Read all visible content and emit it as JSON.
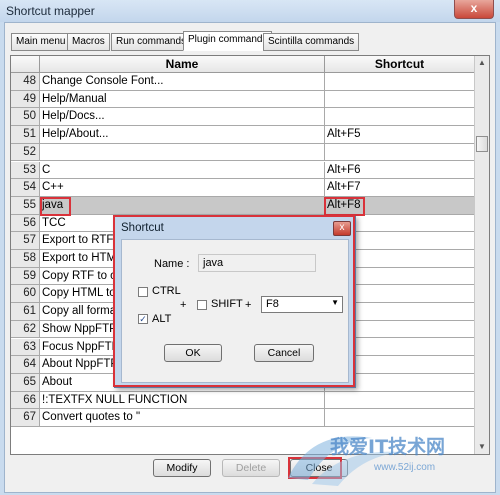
{
  "window": {
    "title": "Shortcut mapper",
    "close_glyph": "x"
  },
  "tabs": [
    "Main menu",
    "Macros",
    "Run commands",
    "Plugin commands",
    "Scintilla commands"
  ],
  "active_tab": "Plugin commands",
  "grid": {
    "columns": [
      "Name",
      "Shortcut"
    ],
    "rows": [
      {
        "num": "48",
        "name": "Change Console Font...",
        "shortcut": ""
      },
      {
        "num": "49",
        "name": "Help/Manual",
        "shortcut": ""
      },
      {
        "num": "50",
        "name": "Help/Docs...",
        "shortcut": ""
      },
      {
        "num": "51",
        "name": "Help/About...",
        "shortcut": "Alt+F5"
      },
      {
        "num": "52",
        "name": "",
        "shortcut": ""
      },
      {
        "num": "53",
        "name": "C",
        "shortcut": "Alt+F6"
      },
      {
        "num": "54",
        "name": "C++",
        "shortcut": "Alt+F7"
      },
      {
        "num": "55",
        "name": "java",
        "shortcut": "Alt+F8",
        "selected": true
      },
      {
        "num": "56",
        "name": "TCC",
        "shortcut": ""
      },
      {
        "num": "57",
        "name": "Export to RTF",
        "shortcut": ""
      },
      {
        "num": "58",
        "name": "Export to HTML",
        "shortcut": ""
      },
      {
        "num": "59",
        "name": "Copy RTF to clipboard",
        "shortcut": ""
      },
      {
        "num": "60",
        "name": "Copy HTML to clipboard",
        "shortcut": ""
      },
      {
        "num": "61",
        "name": "Copy all formats to clipboard",
        "shortcut": ""
      },
      {
        "num": "62",
        "name": "Show NppFTP Window",
        "shortcut": ""
      },
      {
        "num": "63",
        "name": "Focus NppFTP Window",
        "shortcut": ""
      },
      {
        "num": "64",
        "name": "About NppFTP",
        "shortcut": ""
      },
      {
        "num": "65",
        "name": "About",
        "shortcut": ""
      },
      {
        "num": "66",
        "name": "!:TEXTFX NULL FUNCTION",
        "shortcut": ""
      },
      {
        "num": "67",
        "name": "Convert quotes to \"",
        "shortcut": ""
      }
    ]
  },
  "buttons": {
    "modify": "Modify",
    "delete": "Delete",
    "close": "Close"
  },
  "dialog": {
    "title": "Shortcut",
    "close_glyph": "x",
    "name_label": "Name :",
    "name_value": "java",
    "ctrl_label": "CTRL",
    "alt_label": "ALT",
    "shift_label": "SHIFT",
    "plus": "+",
    "check_glyph": "✓",
    "ctrl_checked": false,
    "alt_checked": true,
    "shift_checked": false,
    "key_value": "F8",
    "ok": "OK",
    "cancel": "Cancel"
  },
  "watermark": {
    "brand": "我爱IT技术网",
    "url": "www.52ij.com"
  },
  "colors": {
    "highlight": "#d9323a",
    "selected_row": "#c8c8c8",
    "window_frame": "#c9dbee"
  }
}
